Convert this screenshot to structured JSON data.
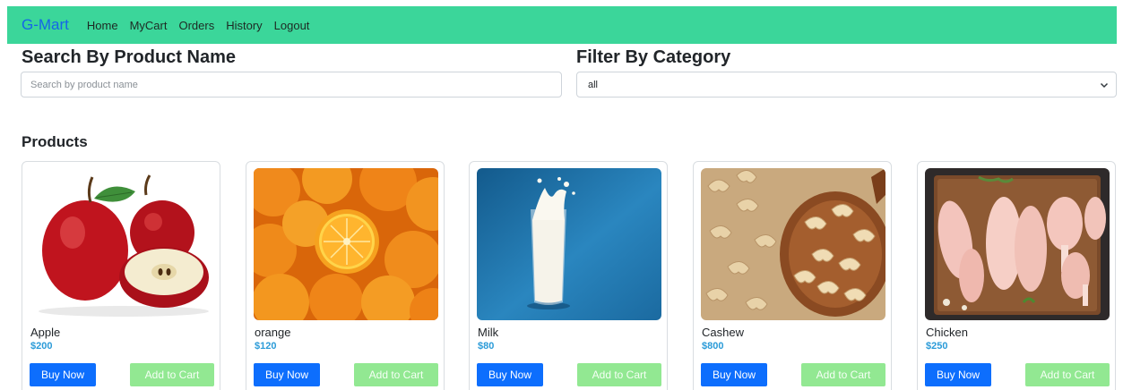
{
  "navbar": {
    "brand": "G-Mart",
    "links": [
      "Home",
      "MyCart",
      "Orders",
      "History",
      "Logout"
    ]
  },
  "search": {
    "title": "Search By Product Name",
    "placeholder": "Search by product name",
    "value": ""
  },
  "filter": {
    "title": "Filter By Category",
    "selected": "all"
  },
  "products_title": "Products",
  "products": [
    {
      "name": "Apple",
      "price": "$200",
      "buy_label": "Buy Now",
      "cart_label": "Add to Cart"
    },
    {
      "name": "orange",
      "price": "$120",
      "buy_label": "Buy Now",
      "cart_label": "Add to Cart"
    },
    {
      "name": "Milk",
      "price": "$80",
      "buy_label": "Buy Now",
      "cart_label": "Add to Cart"
    },
    {
      "name": "Cashew",
      "price": "$800",
      "buy_label": "Buy Now",
      "cart_label": "Add to Cart"
    },
    {
      "name": "Chicken",
      "price": "$250",
      "buy_label": "Buy Now",
      "cart_label": "Add to Cart"
    }
  ],
  "colors": {
    "navbar_bg": "#3bd69a",
    "brand": "#1565e8",
    "price": "#2b9bd8",
    "buy_button": "#0d6efd",
    "cart_button": "#92e892"
  },
  "icons": {
    "select_arrow": "chevron-down-icon"
  }
}
